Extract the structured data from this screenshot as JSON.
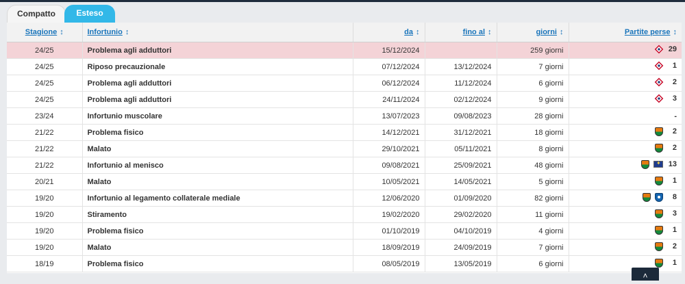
{
  "tabs": [
    {
      "label": "Compatto",
      "active": false
    },
    {
      "label": "Esteso",
      "active": true
    }
  ],
  "table": {
    "headers": {
      "season": "Stagione",
      "injury": "Infortunio",
      "from": "da",
      "until": "fino al",
      "days": "giorni",
      "games": "Partite perse"
    },
    "sort_icon": "↕",
    "rows": [
      {
        "season": "24/25",
        "injury": "Problema agli adduttori",
        "from": "15/12/2024",
        "until": "",
        "days": "259 giorni",
        "clubs": [
          "lille-logo-icon"
        ],
        "games": "29",
        "highlight": true
      },
      {
        "season": "24/25",
        "injury": "Riposo precauzionale",
        "from": "07/12/2024",
        "until": "13/12/2024",
        "days": "7 giorni",
        "clubs": [
          "lille-logo-icon"
        ],
        "games": "1",
        "highlight": false
      },
      {
        "season": "24/25",
        "injury": "Problema agli adduttori",
        "from": "06/12/2024",
        "until": "11/12/2024",
        "days": "6 giorni",
        "clubs": [
          "lille-logo-icon"
        ],
        "games": "2",
        "highlight": false
      },
      {
        "season": "24/25",
        "injury": "Problema agli adduttori",
        "from": "24/11/2024",
        "until": "02/12/2024",
        "days": "9 giorni",
        "clubs": [
          "lille-logo-icon"
        ],
        "games": "3",
        "highlight": false
      },
      {
        "season": "23/24",
        "injury": "Infortunio muscolare",
        "from": "13/07/2023",
        "until": "09/08/2023",
        "days": "28 giorni",
        "clubs": [],
        "games": "-",
        "highlight": false
      },
      {
        "season": "21/22",
        "injury": "Problema fisico",
        "from": "14/12/2021",
        "until": "31/12/2021",
        "days": "18 giorni",
        "clubs": [
          "venezia-logo-icon"
        ],
        "games": "2",
        "highlight": false
      },
      {
        "season": "21/22",
        "injury": "Malato",
        "from": "29/10/2021",
        "until": "05/11/2021",
        "days": "8 giorni",
        "clubs": [
          "venezia-logo-icon"
        ],
        "games": "2",
        "highlight": false
      },
      {
        "season": "21/22",
        "injury": "Infortunio al menisco",
        "from": "09/08/2021",
        "until": "25/09/2021",
        "days": "48 giorni",
        "clubs": [
          "venezia-logo-icon",
          "national-team-logo-icon"
        ],
        "games": "13",
        "highlight": false
      },
      {
        "season": "20/21",
        "injury": "Malato",
        "from": "10/05/2021",
        "until": "14/05/2021",
        "days": "5 giorni",
        "clubs": [
          "venezia-logo-icon"
        ],
        "games": "1",
        "highlight": false
      },
      {
        "season": "19/20",
        "injury": "Infortunio al legamento collaterale mediale",
        "from": "12/06/2020",
        "until": "01/09/2020",
        "days": "82 giorni",
        "clubs": [
          "venezia-logo-icon",
          "genk-logo-icon"
        ],
        "games": "8",
        "highlight": false
      },
      {
        "season": "19/20",
        "injury": "Stiramento",
        "from": "19/02/2020",
        "until": "29/02/2020",
        "days": "11 giorni",
        "clubs": [
          "venezia-logo-icon"
        ],
        "games": "3",
        "highlight": false
      },
      {
        "season": "19/20",
        "injury": "Problema fisico",
        "from": "01/10/2019",
        "until": "04/10/2019",
        "days": "4 giorni",
        "clubs": [
          "venezia-logo-icon"
        ],
        "games": "1",
        "highlight": false
      },
      {
        "season": "19/20",
        "injury": "Malato",
        "from": "18/09/2019",
        "until": "24/09/2019",
        "days": "7 giorni",
        "clubs": [
          "venezia-logo-icon"
        ],
        "games": "2",
        "highlight": false
      },
      {
        "season": "18/19",
        "injury": "Problema fisico",
        "from": "08/05/2019",
        "until": "13/05/2019",
        "days": "6 giorni",
        "clubs": [
          "venezia-logo-icon"
        ],
        "games": "1",
        "highlight": false
      }
    ]
  },
  "scroll_top_icon": "chevron-up-icon"
}
